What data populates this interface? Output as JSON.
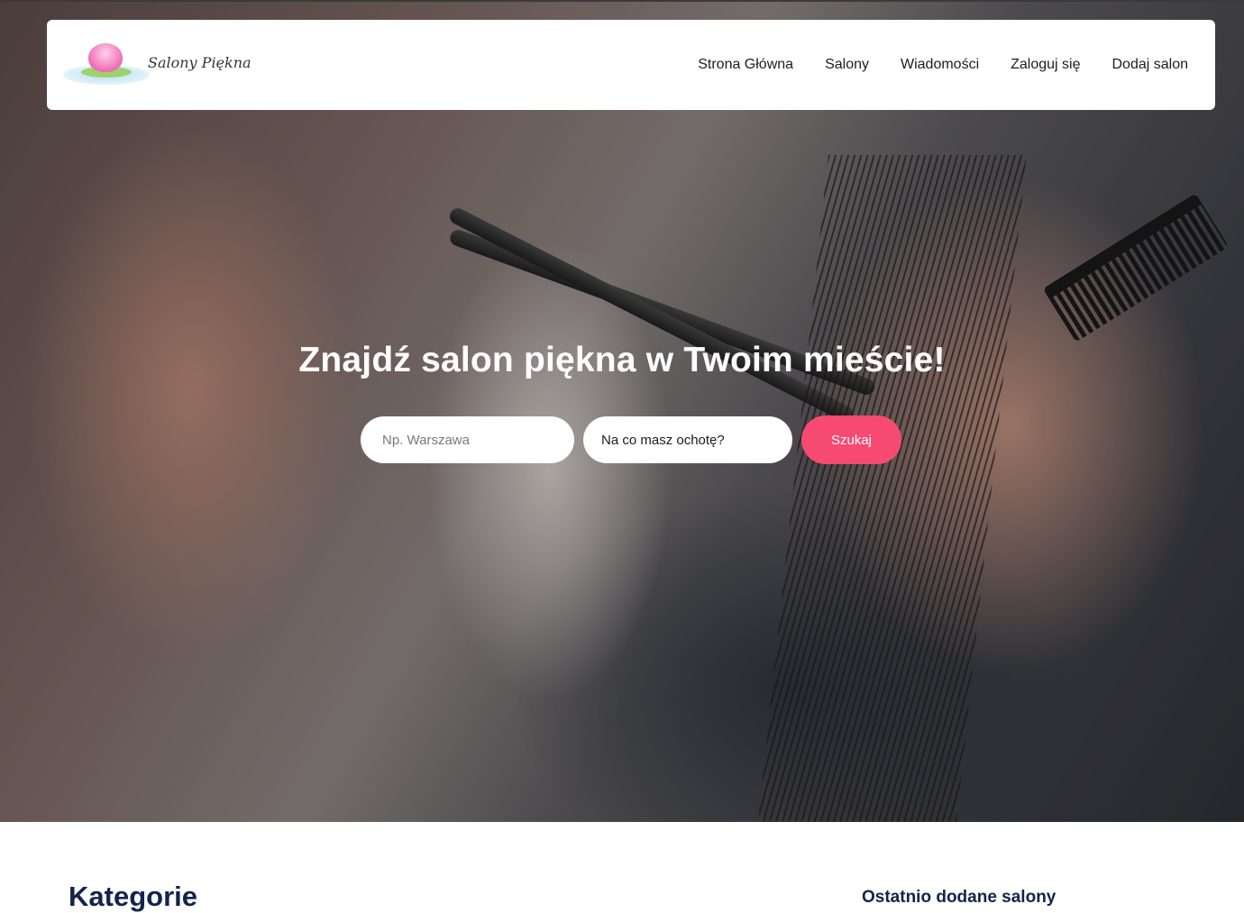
{
  "brand": {
    "name": "Salony Piękna",
    "logo_icon": "lotus-flower-icon"
  },
  "nav": {
    "items": [
      {
        "label": "Strona Główna"
      },
      {
        "label": "Salony"
      },
      {
        "label": "Wiadomości"
      },
      {
        "label": "Zaloguj się"
      },
      {
        "label": "Dodaj salon"
      }
    ]
  },
  "hero": {
    "title": "Znajdź salon piękna w Twoim mieście!",
    "image_subject": "hairdresser cutting hair with scissors and comb"
  },
  "search": {
    "city_placeholder": "Np. Warszawa",
    "city_value": "",
    "category_value": "Na co masz ochotę?",
    "button_label": "Szukaj",
    "button_color": "#f74a72"
  },
  "sections": {
    "categories_title": "Kategorie",
    "recent_title": "Ostatnio dodane salony"
  },
  "colors": {
    "heading": "#12244a",
    "accent": "#f74a72"
  }
}
